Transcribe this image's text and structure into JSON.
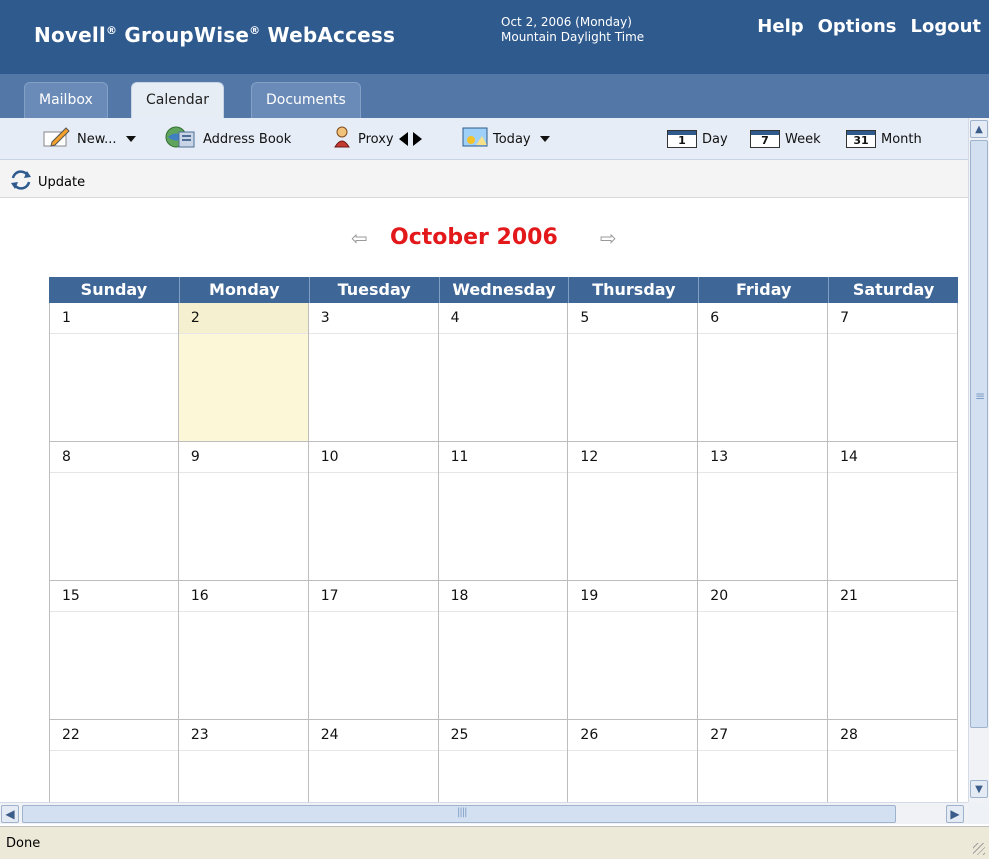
{
  "app": {
    "brand": "Novell",
    "product1": "GroupWise",
    "product2": "WebAccess",
    "reg": "®"
  },
  "header": {
    "date_line1": "Oct 2, 2006 (Monday)",
    "date_line2": "Mountain Daylight Time",
    "links": [
      "Help",
      "Options",
      "Logout"
    ]
  },
  "tabs": [
    {
      "label": "Mailbox",
      "active": false
    },
    {
      "label": "Calendar",
      "active": true
    },
    {
      "label": "Documents",
      "active": false
    }
  ],
  "toolbar": {
    "new_label": "New...",
    "address_book_label": "Address Book",
    "proxy_label": "Proxy",
    "today_label": "Today",
    "day_label": "Day",
    "week_label": "Week",
    "month_label": "Month",
    "day_icon_num": "1",
    "week_icon_num": "7",
    "month_icon_num": "31"
  },
  "updatebar": {
    "update_label": "Update"
  },
  "calendar": {
    "month_title": "October 2006",
    "prev_arrow": "⇦",
    "next_arrow": "⇨",
    "weekdays": [
      "Sunday",
      "Monday",
      "Tuesday",
      "Wednesday",
      "Thursday",
      "Friday",
      "Saturday"
    ],
    "days": [
      "1",
      "2",
      "3",
      "4",
      "5",
      "6",
      "7",
      "8",
      "9",
      "10",
      "11",
      "12",
      "13",
      "14",
      "15",
      "16",
      "17",
      "18",
      "19",
      "20",
      "21",
      "22",
      "23",
      "24",
      "25",
      "26",
      "27",
      "28"
    ],
    "today": "2",
    "colors": {
      "title": "#e3181b",
      "header_bg": "#3e6696",
      "today_bg": "#fbf7d7"
    }
  },
  "status": {
    "text": "Done"
  }
}
